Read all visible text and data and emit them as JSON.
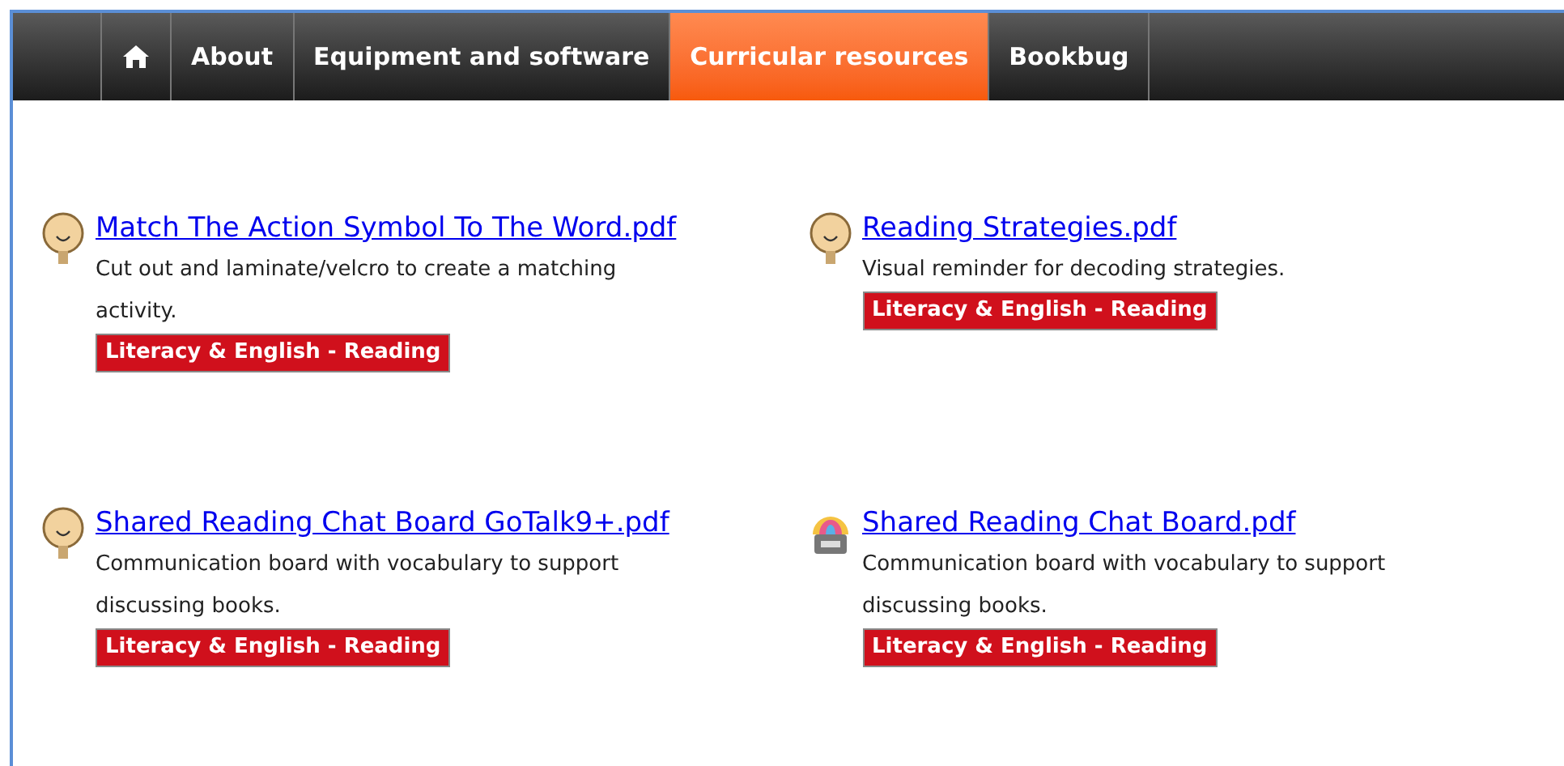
{
  "nav": [
    {
      "kind": "home",
      "selected": false
    },
    {
      "label": "About",
      "selected": false
    },
    {
      "label": "Equipment and software",
      "selected": false
    },
    {
      "label": "Curricular resources",
      "selected": true
    },
    {
      "label": "Bookbug",
      "selected": false
    }
  ],
  "resources": [
    {
      "kind": "face",
      "title": "Match The Action Symbol To The Word.pdf",
      "description": "Cut out and laminate/velcro to create a matching activity.",
      "tag": "Literacy & English - Reading"
    },
    {
      "kind": "face",
      "title": "Reading Strategies.pdf",
      "description": "Visual reminder for decoding strategies.",
      "tag": "Literacy & English - Reading"
    },
    {
      "kind": "face",
      "title": "Shared Reading Chat Board GoTalk9+.pdf",
      "description": "Communication board with vocabulary to support discussing books.",
      "tag": "Literacy & English - Reading"
    },
    {
      "kind": "rainbow",
      "title": "Shared Reading Chat Board.pdf",
      "description": "Communication board with vocabulary to support discussing books.",
      "tag": "Literacy & English - Reading"
    }
  ]
}
